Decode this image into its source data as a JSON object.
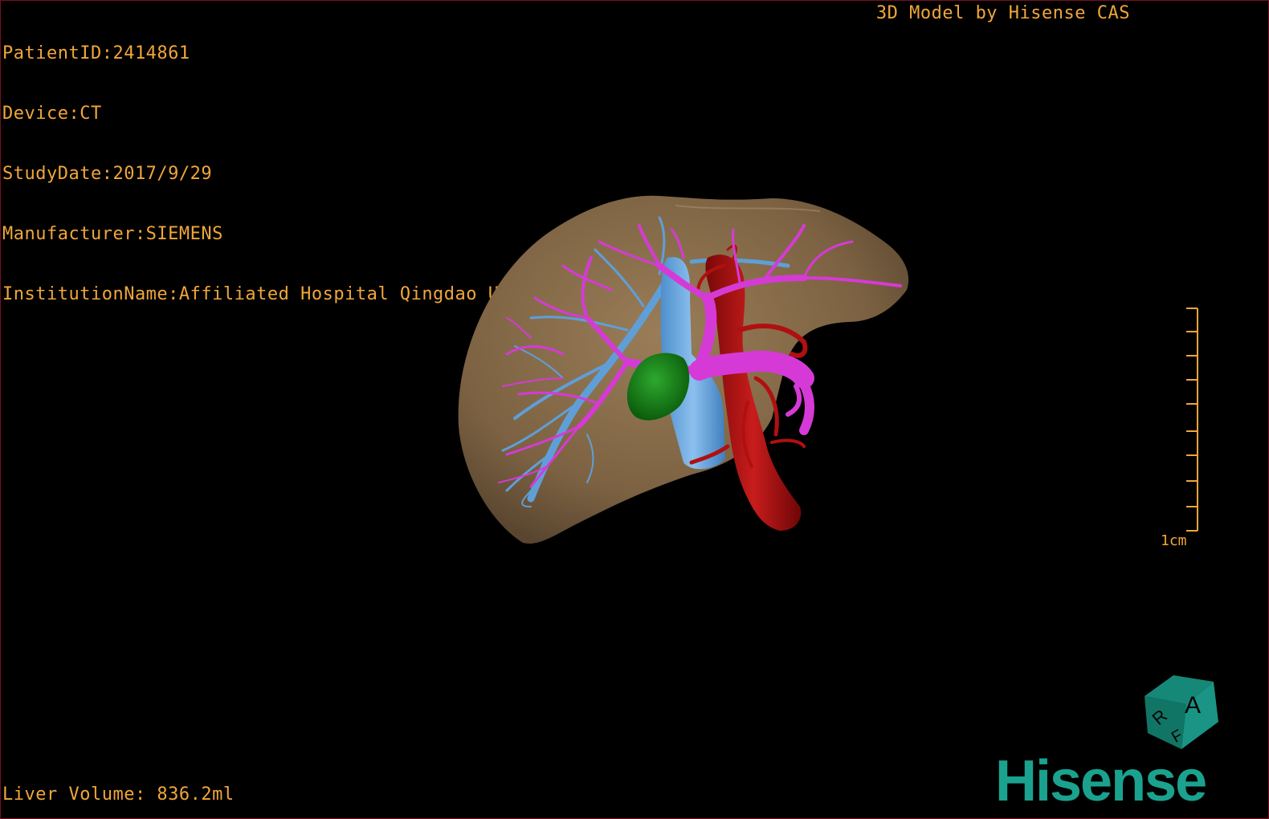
{
  "patient_id": "PatientID:2414861",
  "device": "Device:CT",
  "study_date": "StudyDate:2017/9/29",
  "manufacturer": "Manufacturer:SIEMENS",
  "institution": "InstitutionName:Affiliated Hospital Qingdao University-C",
  "credit": "3D Model by Hisense CAS",
  "liver_volume": "Liver Volume: 836.2ml",
  "scale_label": "1cm",
  "orientation_cube": {
    "face_top": "A",
    "face_left": "R",
    "face_bottom": "F"
  },
  "brand_logo": "Hisense",
  "colors": {
    "overlay_text": "#f0a63a",
    "liver": "#8a6d4a",
    "portal_vein": "#d63ad6",
    "hepatic_vein": "#5f9fd8",
    "artery": "#b01010",
    "tumor": "#1a8a1a",
    "brand": "#1aa28f",
    "border": "#7a0e1e"
  }
}
